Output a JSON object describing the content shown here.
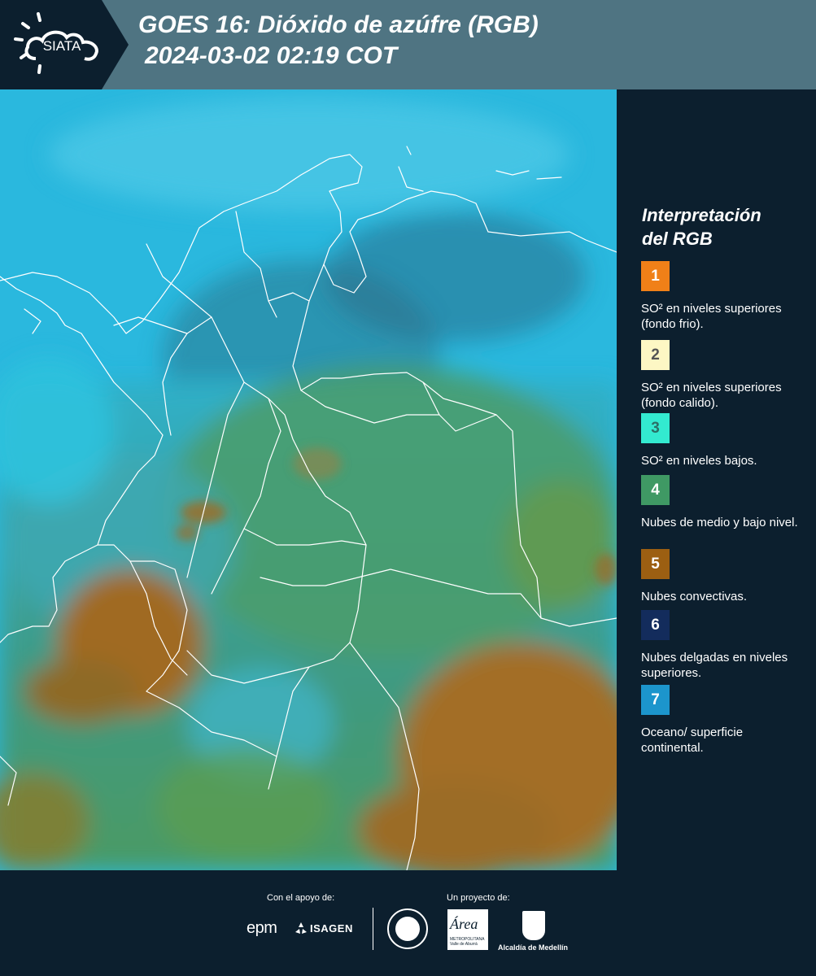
{
  "header": {
    "logo_text": "SIATA",
    "title_line1": "GOES 16: Dióxido de azúfre (RGB)",
    "title_line2": "2024-03-02 02:19 COT"
  },
  "legend": {
    "title_line1": "Interpretación",
    "title_line2": "del RGB",
    "items": [
      {
        "number": "1",
        "label": "SO² en niveles superiores (fondo frio).",
        "color": "#f08018",
        "text_color": "#ffffff"
      },
      {
        "number": "2",
        "label": "SO² en niveles superiores (fondo calido).",
        "color": "#fdf7c4",
        "text_color": "#555555"
      },
      {
        "number": "3",
        "label": "SO² en niveles bajos.",
        "color": "#33ead0",
        "text_color": "#2b6f66"
      },
      {
        "number": "4",
        "label": "Nubes de medio y bajo nivel.",
        "color": "#3f9964",
        "text_color": "#ffffff"
      },
      {
        "number": "5",
        "label": "Nubes convectivas.",
        "color": "#9c5f12",
        "text_color": "#ffffff"
      },
      {
        "number": "6",
        "label": "Nubes delgadas en niveles superiores.",
        "color": "#132c5c",
        "text_color": "#ffffff"
      },
      {
        "number": "7",
        "label": "Oceano/ superficie continental.",
        "color": "#1c95cc",
        "text_color": "#ffffff"
      }
    ]
  },
  "footer": {
    "support_label": "Con el apoyo de:",
    "project_label": "Un proyecto de:",
    "sponsor_epm": "epm",
    "sponsor_isagen": "ISAGEN",
    "partner_area": "Área",
    "partner_area_sub": "METROPOLITANA Valle de Aburrá",
    "partner_alcaldia": "Alcaldía de Medellín"
  },
  "colors": {
    "header_bg": "#4f7482",
    "panel_bg": "#0c1f2e",
    "ocean": "#2bb7dc",
    "land_green": "#3f9a78",
    "convective": "#a26a1f",
    "border_line": "#ffffff"
  }
}
